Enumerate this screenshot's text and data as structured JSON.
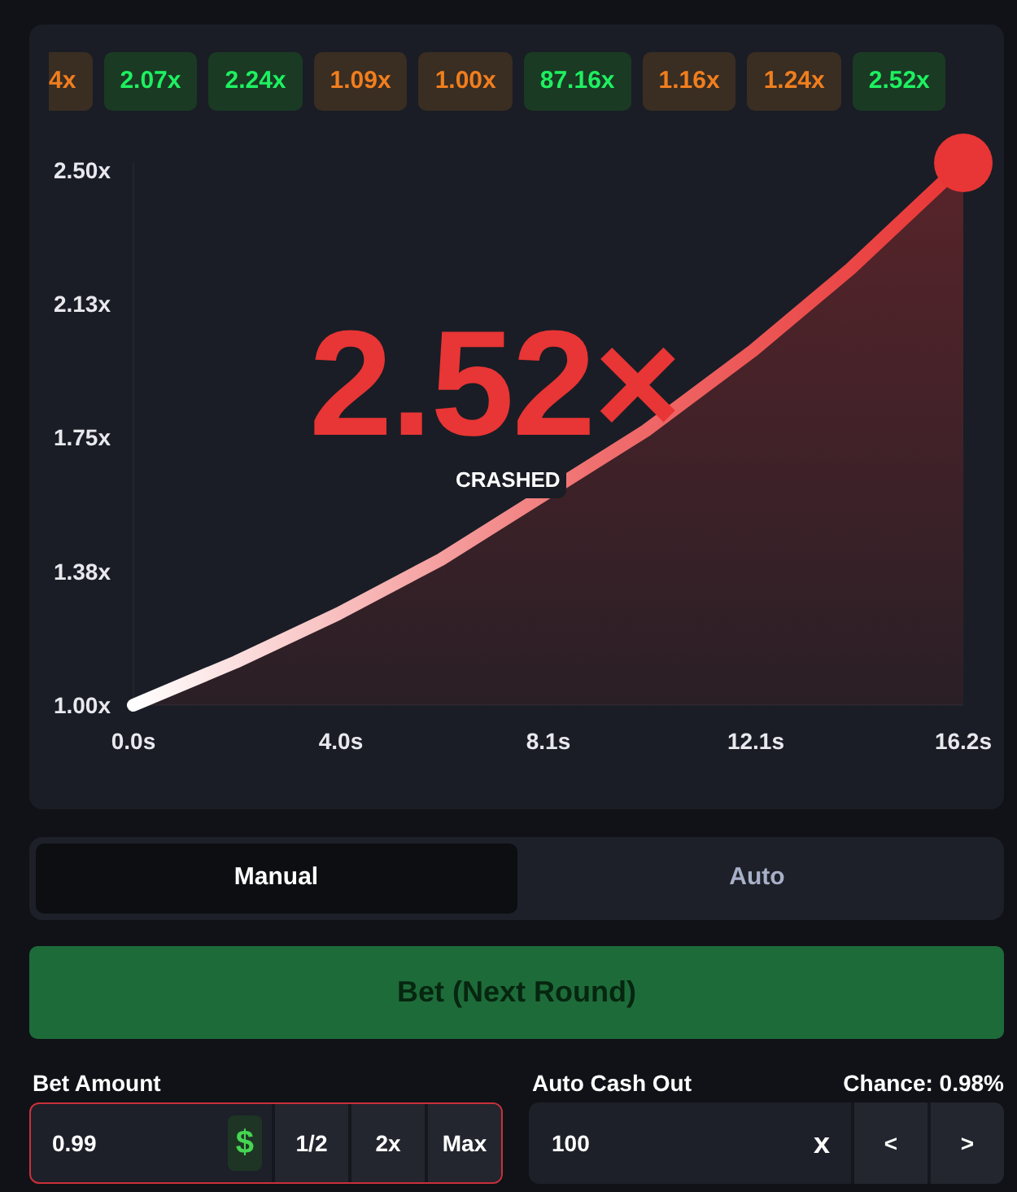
{
  "history": [
    {
      "label": "4x",
      "color": "#3a2d22"
    },
    {
      "label": "2.07x",
      "color": "#1a3a24"
    },
    {
      "label": "2.24x",
      "color": "#1a3a24"
    },
    {
      "label": "1.09x",
      "color": "#3a2d22"
    },
    {
      "label": "1.00x",
      "color": "#3a2d22"
    },
    {
      "label": "87.16x",
      "color": "#1a3a24"
    },
    {
      "label": "1.16x",
      "color": "#3a2d22"
    },
    {
      "label": "1.24x",
      "color": "#3a2d22"
    },
    {
      "label": "2.52x",
      "color": "#1a3a24"
    }
  ],
  "game": {
    "multiplier": "2.52×",
    "status": "CRASHED",
    "chart_data": {
      "type": "area",
      "x": [
        0,
        2,
        4,
        6,
        10,
        12.1,
        14,
        16.2
      ],
      "series": [
        {
          "color": "#e83535",
          "values": [
            1.0,
            1.121,
            1.256,
            1.408,
            1.769,
            1.994,
            2.223,
            2.52
          ]
        }
      ],
      "xlim": [
        0,
        16.2
      ],
      "ylim": [
        1.0,
        2.52
      ],
      "xticks": [
        {
          "value": 0,
          "label": "0.0s"
        },
        {
          "value": 4.05,
          "label": "4.0s"
        },
        {
          "value": 8.1,
          "label": "8.1s"
        },
        {
          "value": 12.15,
          "label": "12.1s"
        },
        {
          "value": 16.2,
          "label": "16.2s"
        }
      ],
      "yticks": [
        {
          "value": 1.0,
          "label": "1.00x"
        },
        {
          "value": 1.375,
          "label": "1.38x"
        },
        {
          "value": 1.75,
          "label": "1.75x"
        },
        {
          "value": 2.125,
          "label": "2.13x"
        },
        {
          "value": 2.5,
          "label": "2.50x"
        }
      ]
    }
  },
  "tabs": [
    {
      "label": "Manual",
      "selected": true
    },
    {
      "label": "Auto",
      "selected": false
    }
  ],
  "bet_button": {
    "label": "Bet (Next Round)",
    "disabled": true
  },
  "bet_amount": {
    "label": "Bet Amount",
    "value": "0.99",
    "currency": "$",
    "invalid": true,
    "buttons": [
      "1/2",
      "2x",
      "Max"
    ]
  },
  "auto_cash_out": {
    "label": "Auto Cash Out",
    "chance": "Chance: 0.98%",
    "value": "100",
    "suffix": "x",
    "buttons": [
      "<",
      ">"
    ]
  }
}
